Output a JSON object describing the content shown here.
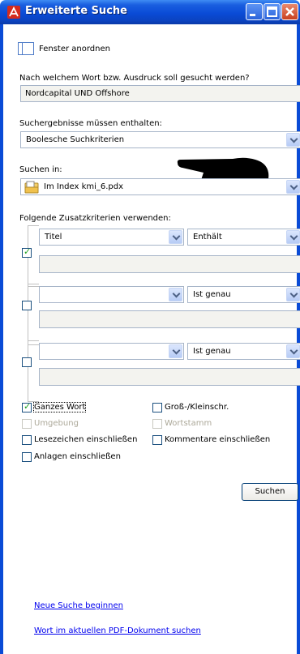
{
  "window": {
    "title": "Erweiterte Suche"
  },
  "arrange": {
    "label": "Fenster anordnen"
  },
  "query": {
    "label": "Nach welchem Wort bzw. Ausdruck soll gesucht werden?",
    "value": "Nordcapital UND Offshore"
  },
  "results": {
    "label": "Suchergebnisse müssen enthalten:",
    "value": "Boolesche Suchkriterien"
  },
  "search_in": {
    "label": "Suchen in:",
    "value": "Im Index kmi_6.pdx"
  },
  "criteria": {
    "label": "Folgende Zusatzkriterien verwenden:",
    "rows": [
      {
        "field": "Titel",
        "operator": "Enthält",
        "checked": true,
        "value": ""
      },
      {
        "field": "",
        "operator": "Ist genau",
        "checked": false,
        "value": ""
      },
      {
        "field": "",
        "operator": "Ist genau",
        "checked": false,
        "value": ""
      }
    ]
  },
  "options": {
    "whole_word": "Ganzes Wort",
    "case": "Groß-/Kleinschr.",
    "proximity": "Umgebung",
    "stemming": "Wortstamm",
    "bookmarks": "Lesezeichen einschließen",
    "comments": "Kommentare einschließen",
    "attachments": "Anlagen einschließen"
  },
  "search_button": "Suchen",
  "links": {
    "new_search": "Neue Suche beginnen",
    "current_doc": "Wort im aktuellen PDF-Dokument suchen"
  },
  "colors": {
    "titlebar": "#0a4bd6",
    "check": "#21a121",
    "link": "#0000ee"
  }
}
